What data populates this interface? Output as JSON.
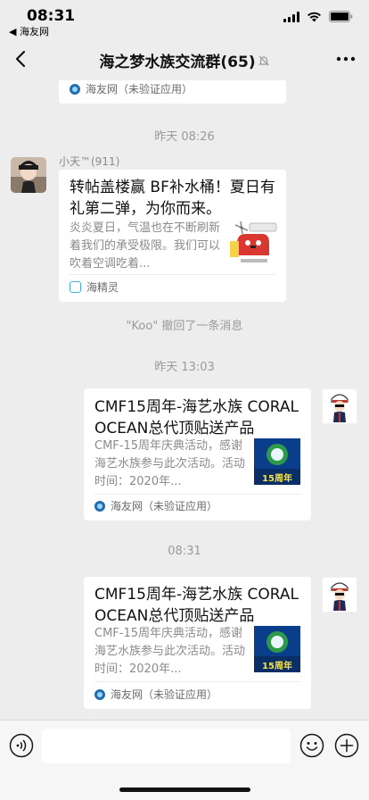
{
  "status_bar": {
    "time": "08:31",
    "back_app": "◀ 海友网"
  },
  "nav": {
    "title": "海之梦水族交流群(65)"
  },
  "messages": {
    "top_card": {
      "source": "海友网（未验证应用）"
    },
    "ts1": "昨天 08:26",
    "msg1": {
      "sender": "小天™(911)",
      "title": "转帖盖楼赢 BF补水桶！夏日有礼第二弹，为你而来。",
      "desc": "炎炎夏日，气温也在不断刷新着我们的承受极限。我们可以吹着空调吃着...",
      "source": "海精灵"
    },
    "recall": "\"Koo\" 撤回了一条消息",
    "ts2": "昨天 13:03",
    "msg2": {
      "title": "CMF15周年-海艺水族 CORAL OCEAN总代顶贴送产品",
      "desc": "CMF-15周年庆典活动，感谢海艺水族参与此次活动。活动时间：2020年...",
      "source": "海友网（未验证应用）",
      "thumb_text": "15周年"
    },
    "ts3": "08:31",
    "msg3": {
      "title": "CMF15周年-海艺水族 CORAL OCEAN总代顶贴送产品",
      "desc": "CMF-15周年庆典活动，感谢海艺水族参与此次活动。活动时间：2020年...",
      "source": "海友网（未验证应用）",
      "thumb_text": "15周年"
    }
  },
  "input": {
    "placeholder": ""
  },
  "icons": {
    "back": "chevron-left-icon",
    "more": "more-dots-icon",
    "mute": "mute-bell-icon",
    "voice": "voice-icon",
    "emoji": "emoji-icon",
    "plus": "plus-icon"
  },
  "colors": {
    "background": "#ededed",
    "card": "#ffffff",
    "meta_text": "#9a9a9a"
  }
}
